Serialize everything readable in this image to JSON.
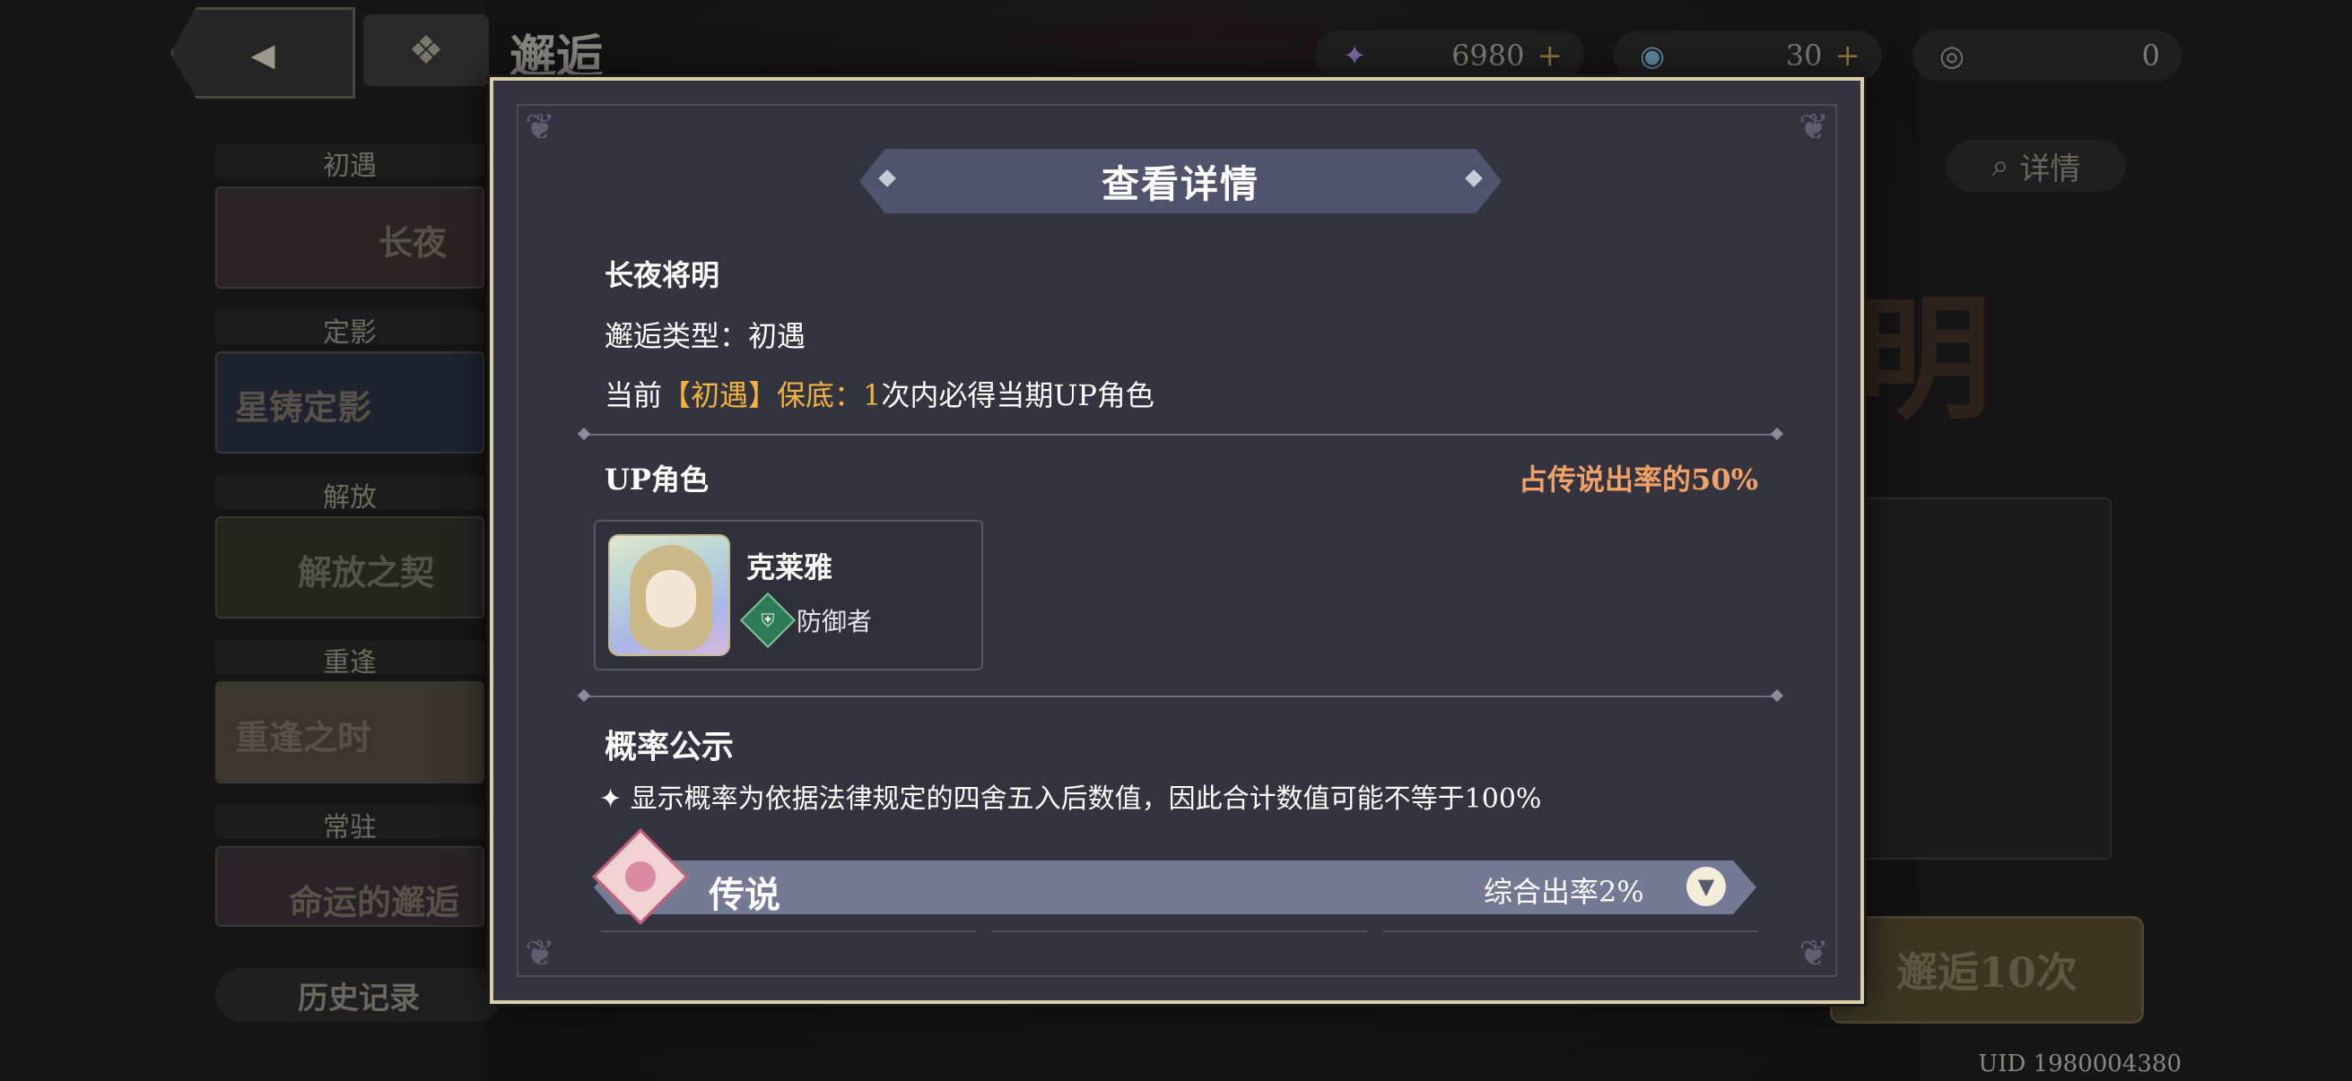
{
  "background": {
    "page_title": "邂逅",
    "resources": [
      {
        "icon": "star-crystal-icon",
        "value": "6980",
        "plus": "+"
      },
      {
        "icon": "feather-orb-icon",
        "value": "30",
        "plus": "+"
      },
      {
        "icon": "swirl-coin-icon",
        "value": "0",
        "plus": ""
      }
    ],
    "banner_categories": [
      {
        "label": "初遇",
        "title": "长夜"
      },
      {
        "label": "定影",
        "title": "星铸定影"
      },
      {
        "label": "解放",
        "title": "解放之契"
      },
      {
        "label": "重逢",
        "title": "重逢之时"
      },
      {
        "label": "常驻",
        "title": "命运的邂逅"
      }
    ],
    "history_button": "历史记录",
    "detail_button": "详情",
    "pull_button": "邂逅10次",
    "uid": "UID 1980004380"
  },
  "modal": {
    "title": "查看详情",
    "banner_name": "长夜将明",
    "type_line": "邂逅类型：初遇",
    "pity_prefix": "当前",
    "pity_highlight": "【初遇】保底：",
    "pity_count": "1",
    "pity_suffix": "次内必得当期UP角色",
    "up_section_title": "UP角色",
    "up_rate_text": "占传说出率的50%",
    "up_character": {
      "name": "克莱雅",
      "role": "防御者",
      "role_icon": "shield-icon"
    },
    "prob_title": "概率公示",
    "prob_note": "✦ 显示概率为依据法律规定的四舍五入后数值，因此合计数值可能不等于100%",
    "tier": {
      "label": "传说",
      "rate_text": "综合出率2%"
    }
  },
  "colors": {
    "gold": "#f2b23e",
    "orange": "#f2a066",
    "frame": "#d8cfa8",
    "panel": "#33343f"
  }
}
